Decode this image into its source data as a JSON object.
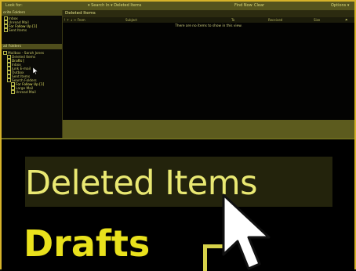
{
  "topbar": {
    "left": "Look for:",
    "search_in": "▾ Search In ▾  Deleted Items",
    "find_now": "Find Now",
    "clear": "Clear",
    "options": "Options ▾"
  },
  "nav": {
    "favorites_header": "orite Folders",
    "favorites": [
      "Inbox",
      "Unread Mail",
      "For Follow Up [1]",
      "Sent Items"
    ],
    "all_folders_header": "ail Folders",
    "folders": [
      "Mailbox - Sarah Jones",
      "Deleted Items",
      "Drafts [",
      "Inbox",
      "Junk E-mail",
      "Outbox",
      "Sent Items",
      "Search Folders",
      "For Follow Up [1]",
      "Large Mail",
      "Unread Mail"
    ]
  },
  "main": {
    "title": "Deleted Items",
    "columns": [
      "! ↑ ↓ ✂ From",
      "Subject",
      "To",
      "Received",
      "Size",
      "⚑"
    ],
    "empty_message": "There are no items to show in this view."
  },
  "zoom": {
    "deleted": "Deleted Items",
    "drafts": "Drafts"
  },
  "colors": {
    "frame": "#d6b32a",
    "accent_yellow": "#e9e872",
    "panel_olive": "#5c5b1e"
  },
  "icons": [
    "folder-icon",
    "mouse-pointer-icon"
  ]
}
